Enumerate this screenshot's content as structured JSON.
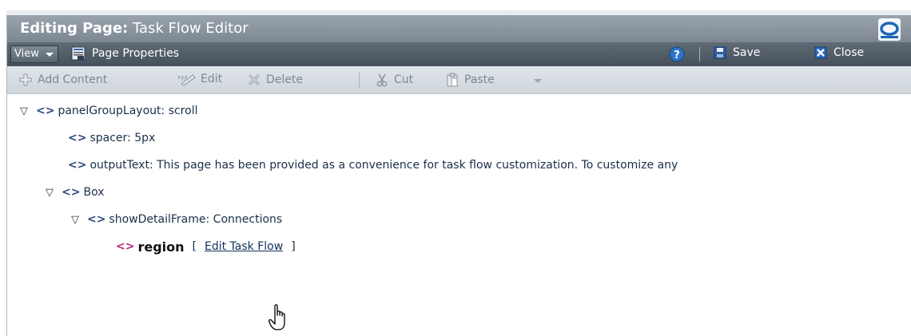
{
  "window": {
    "title_bold": "Editing Page:",
    "title_rest": " Task Flow Editor",
    "logo_icon": "oracle-logo-icon"
  },
  "menubar": {
    "view_label": "View",
    "page_properties_label": "Page Properties",
    "help_icon": "help-icon",
    "save_label": "Save",
    "close_label": "Close"
  },
  "toolbar": {
    "add_content_label": "Add Content",
    "edit_label": "Edit",
    "delete_label": "Delete",
    "cut_label": "Cut",
    "paste_label": "Paste"
  },
  "tree": {
    "nodes": [
      {
        "label": "panelGroupLayout: scroll",
        "expanded": true
      },
      {
        "label": "spacer: 5px"
      },
      {
        "label": "outputText: This page has been provided as a convenience for task flow customization. To customize any"
      },
      {
        "label": "Box",
        "expanded": true
      },
      {
        "label": "showDetailFrame: Connections",
        "expanded": true
      },
      {
        "label": "region",
        "selected": true
      }
    ],
    "region_bracket_open": "[",
    "region_link": "Edit Task Flow",
    "region_bracket_close": "]"
  },
  "colors": {
    "titlebar": "#8a959f",
    "menubar": "#525e69",
    "toolbar": "#d7dde2",
    "tag_blue": "#2b4a78",
    "tag_magenta": "#c0227a"
  }
}
